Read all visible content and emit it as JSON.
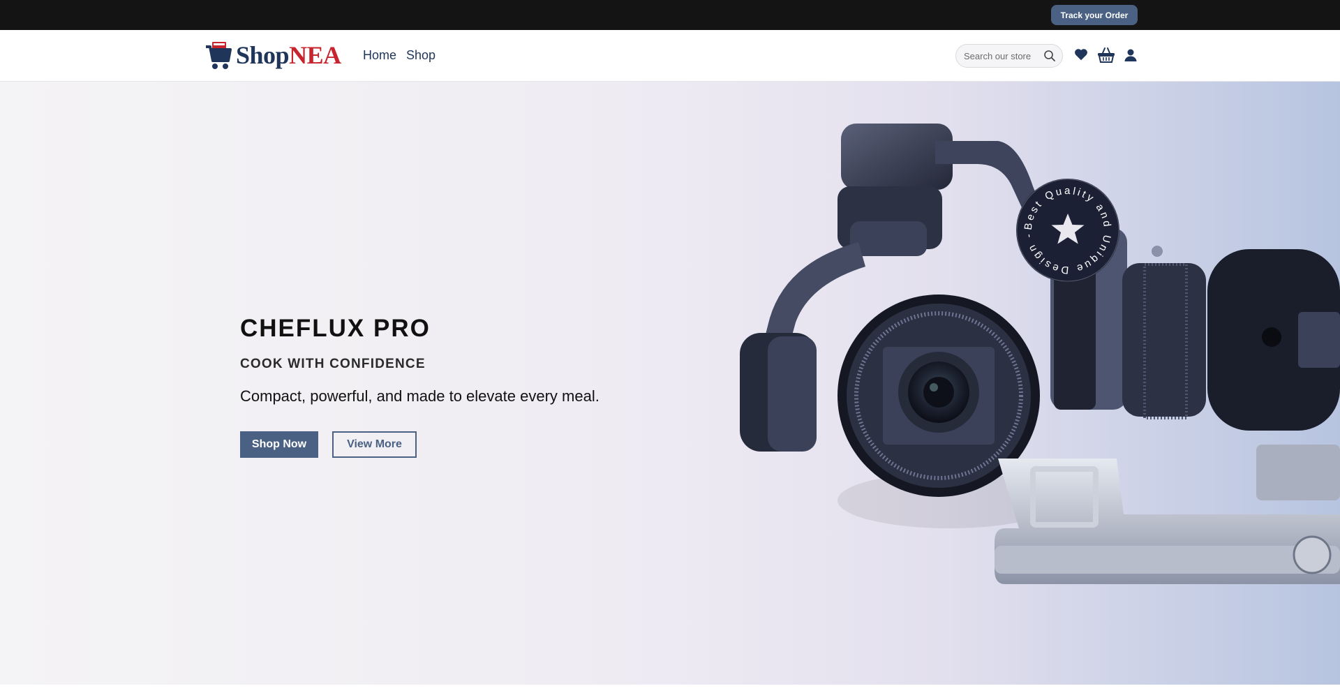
{
  "topbar": {
    "track_label": "Track your Order"
  },
  "header": {
    "logo": {
      "part1": "Shop",
      "part2": "NEA"
    },
    "nav": [
      {
        "label": "Home"
      },
      {
        "label": "Shop"
      }
    ],
    "search": {
      "placeholder": "Search our store",
      "value": ""
    },
    "icons": [
      "heart-icon",
      "basket-icon",
      "user-icon",
      "search-icon"
    ]
  },
  "hero": {
    "title": "CHEFLUX PRO",
    "subtitle": "COOK WITH CONFIDENCE",
    "description": "Compact, powerful, and made to elevate every meal.",
    "primary_button": "Shop Now",
    "secondary_button": "View More",
    "badge_text": "Best Quality and Unique Design -"
  },
  "colors": {
    "accent": "#4a6184",
    "brand_dark": "#1f355a",
    "brand_red": "#c8242e",
    "topbar": "#141414"
  }
}
